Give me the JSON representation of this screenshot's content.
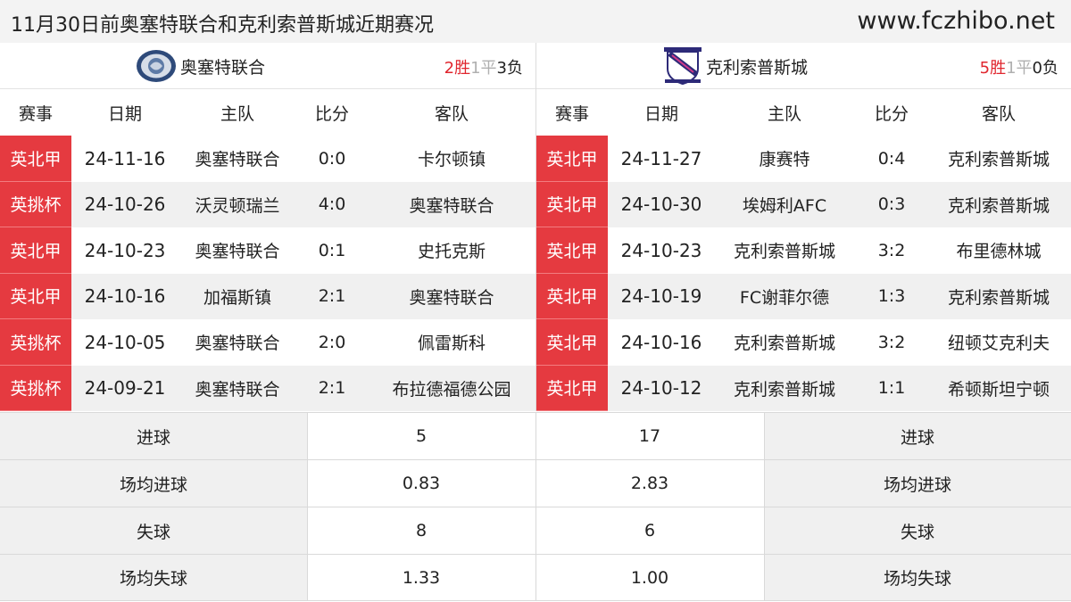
{
  "header": {
    "title": "11月30日前奥塞特联合和克利索普斯城近期赛况",
    "site": "www.fczhibo.net"
  },
  "columns": [
    "赛事",
    "日期",
    "主队",
    "比分",
    "客队"
  ],
  "left": {
    "team": "奥塞特联合",
    "record": {
      "win": "2胜",
      "draw": "1平",
      "loss": "3负"
    },
    "matches": [
      {
        "comp": "英北甲",
        "date": "24-11-16",
        "home": "奥塞特联合",
        "score": "0:0",
        "away": "卡尔顿镇"
      },
      {
        "comp": "英挑杯",
        "date": "24-10-26",
        "home": "沃灵顿瑞兰",
        "score": "4:0",
        "away": "奥塞特联合"
      },
      {
        "comp": "英北甲",
        "date": "24-10-23",
        "home": "奥塞特联合",
        "score": "0:1",
        "away": "史托克斯"
      },
      {
        "comp": "英北甲",
        "date": "24-10-16",
        "home": "加福斯镇",
        "score": "2:1",
        "away": "奥塞特联合"
      },
      {
        "comp": "英挑杯",
        "date": "24-10-05",
        "home": "奥塞特联合",
        "score": "2:0",
        "away": "佩雷斯科"
      },
      {
        "comp": "英挑杯",
        "date": "24-09-21",
        "home": "奥塞特联合",
        "score": "2:1",
        "away": "布拉德福德公园"
      }
    ]
  },
  "right": {
    "team": "克利索普斯城",
    "record": {
      "win": "5胜",
      "draw": "1平",
      "loss": "0负"
    },
    "matches": [
      {
        "comp": "英北甲",
        "date": "24-11-27",
        "home": "康赛特",
        "score": "0:4",
        "away": "克利索普斯城"
      },
      {
        "comp": "英北甲",
        "date": "24-10-30",
        "home": "埃姆利AFC",
        "score": "0:3",
        "away": "克利索普斯城"
      },
      {
        "comp": "英北甲",
        "date": "24-10-23",
        "home": "克利索普斯城",
        "score": "3:2",
        "away": "布里德林城"
      },
      {
        "comp": "英北甲",
        "date": "24-10-19",
        "home": "FC谢菲尔德",
        "score": "1:3",
        "away": "克利索普斯城"
      },
      {
        "comp": "英北甲",
        "date": "24-10-16",
        "home": "克利索普斯城",
        "score": "3:2",
        "away": "纽顿艾克利夫"
      },
      {
        "comp": "英北甲",
        "date": "24-10-12",
        "home": "克利索普斯城",
        "score": "1:1",
        "away": "希顿斯坦宁顿"
      }
    ]
  },
  "stats": [
    {
      "label": "进球",
      "left": "5",
      "right": "17"
    },
    {
      "label": "场均进球",
      "left": "0.83",
      "right": "2.83"
    },
    {
      "label": "失球",
      "left": "8",
      "right": "6"
    },
    {
      "label": "场均失球",
      "left": "1.33",
      "right": "1.00"
    }
  ],
  "colors": {
    "competition_badge": "#e53a40",
    "win": "#e0262e",
    "draw": "#b0b0b0"
  },
  "icons": {
    "left_logo": "club-crest-icon",
    "right_logo": "club-shield-icon"
  }
}
